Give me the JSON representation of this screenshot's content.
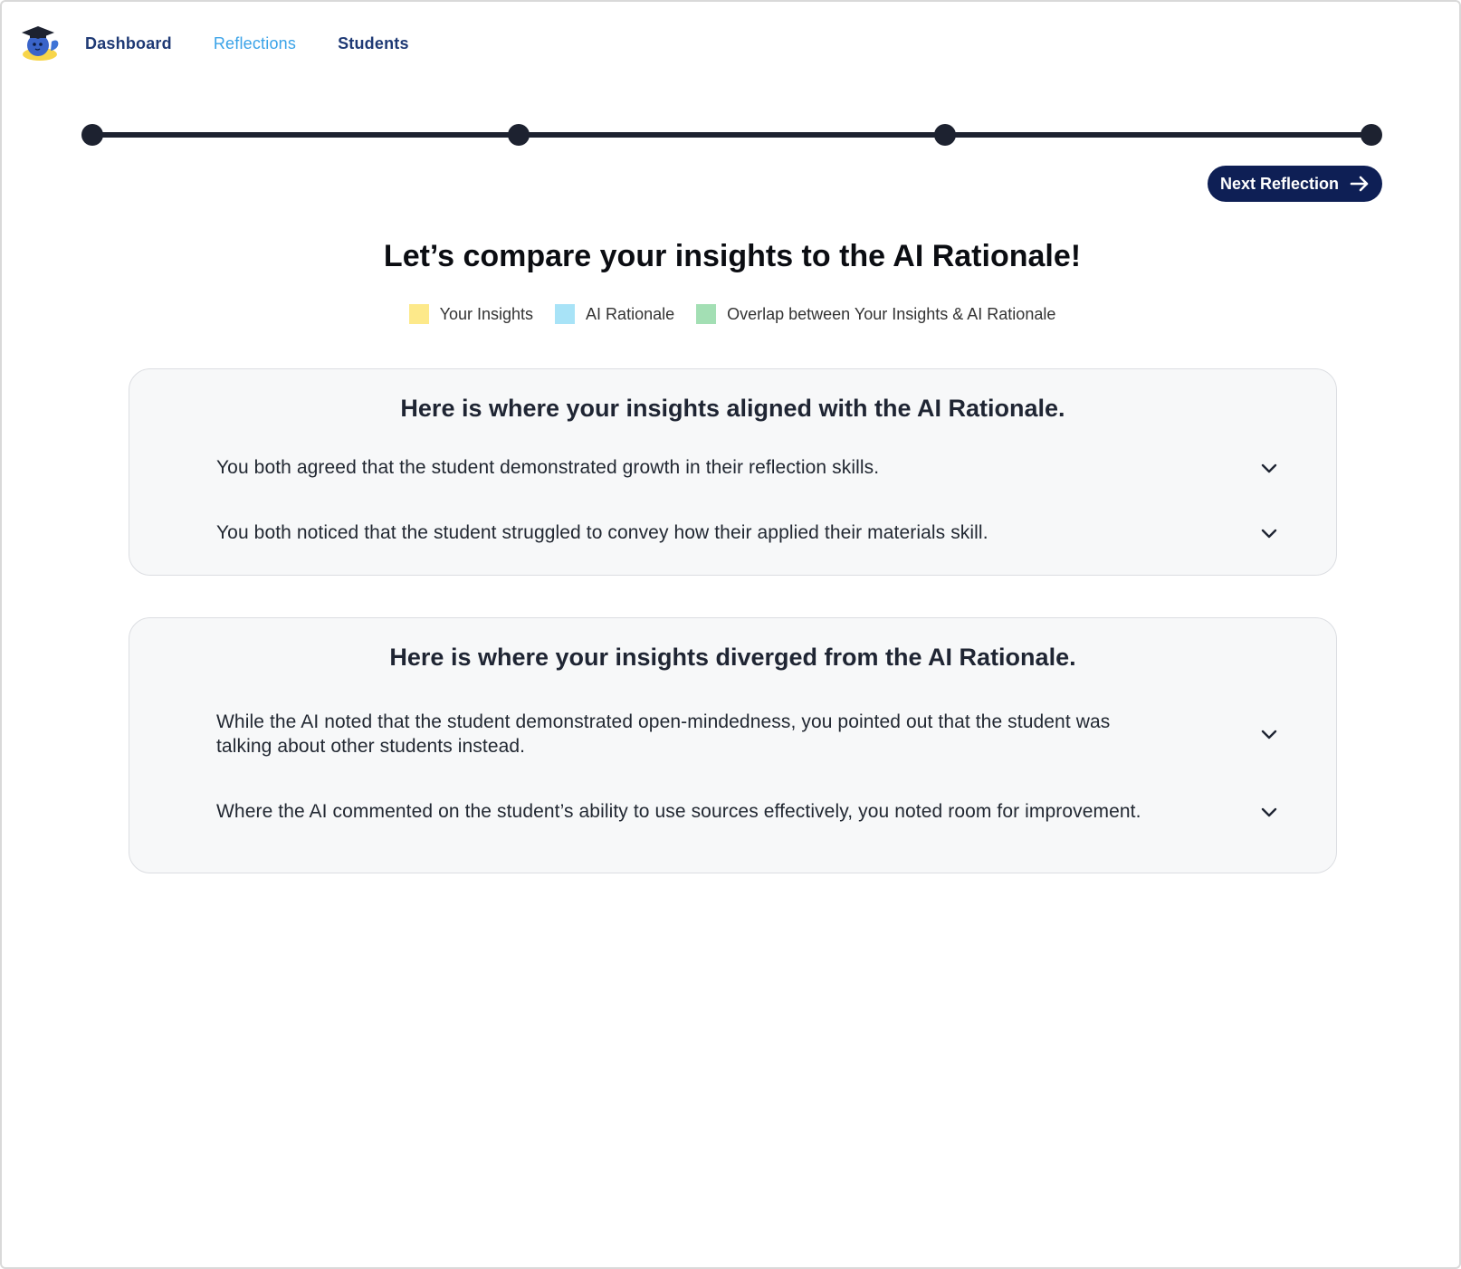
{
  "nav": {
    "links": [
      {
        "label": "Dashboard",
        "state": "default"
      },
      {
        "label": "Reflections",
        "state": "active"
      },
      {
        "label": "Students",
        "state": "default"
      }
    ]
  },
  "stepper": {
    "steps": 4
  },
  "next_button": {
    "label": "Next Reflection",
    "icon": "arrow-right-icon"
  },
  "title": "Let’s compare your insights to the AI Rationale!",
  "legend": [
    {
      "label": "Your Insights",
      "color": "#fde98a"
    },
    {
      "label": "AI Rationale",
      "color": "#a8e3f7"
    },
    {
      "label": "Overlap between Your Insights & AI Rationale",
      "color": "#a3dfb4"
    }
  ],
  "aligned": {
    "heading": "Here is where your insights aligned with the AI Rationale.",
    "items": [
      "You both agreed that the student demonstrated growth in their reflection skills.",
      "You both noticed that the student struggled to convey how their applied their materials skill."
    ]
  },
  "diverged": {
    "heading": "Here is where your insights diverged from the AI Rationale.",
    "items": [
      "While the AI noted that the student demonstrated open-mindedness, you pointed out that the student was talking about other students instead.",
      "Where the AI commented on the student’s ability to use sources effectively, you noted room for improvement."
    ]
  },
  "colors": {
    "nav_dark": "#1f3a75",
    "nav_active": "#3aa3e8",
    "button_bg": "#0e1f55",
    "stepper": "#1d2230"
  }
}
